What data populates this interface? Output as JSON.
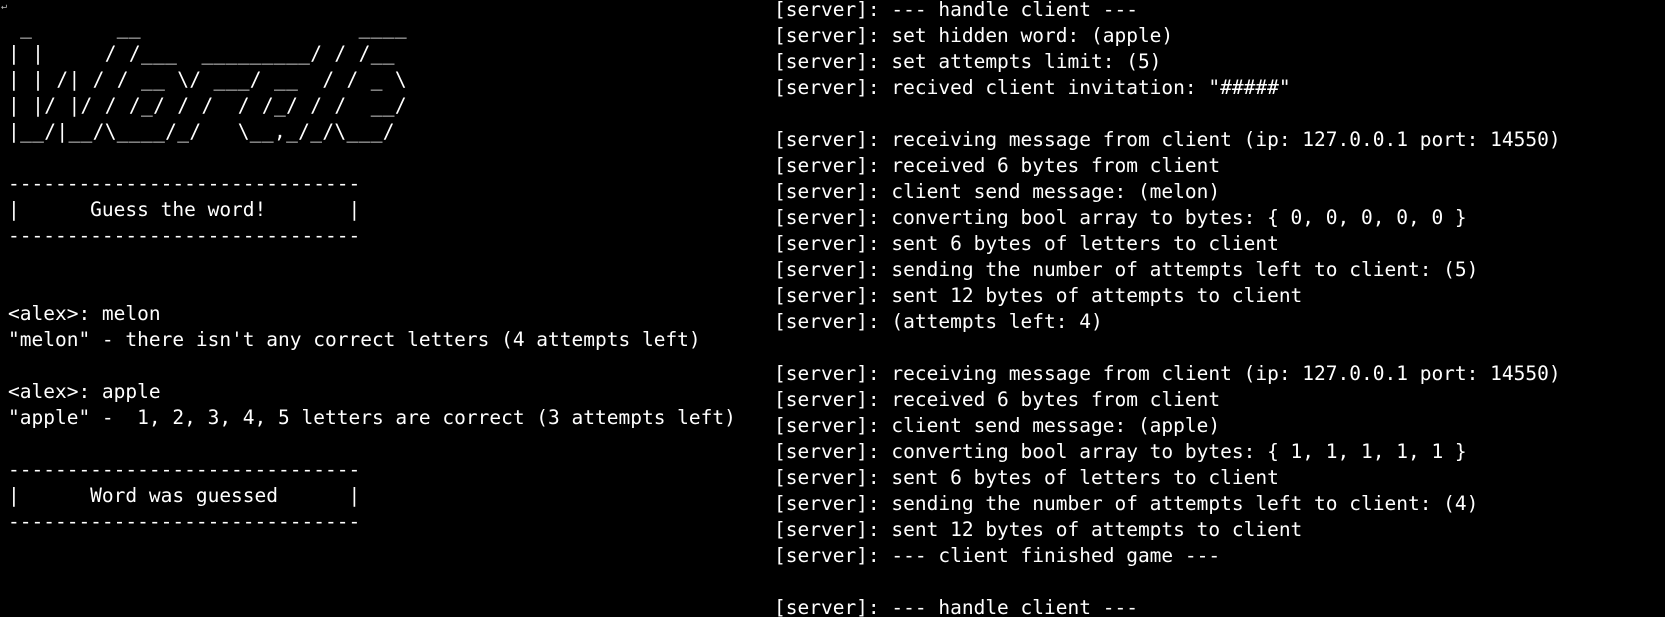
{
  "client": {
    "cursor_glyph": "↵",
    "banner": " _       __                  ____\n| |     / /___  _________/ / /__\n| | /| / / __ \\/ ___/ __  / / _ \\\n| |/ |/ / /_/ / /  / /_/ / /  __/\n|__/|__/\\____/_/   \\__,_/_/\\___/",
    "lines": [
      "",
      "------------------------------",
      "|      Guess the word!       |",
      "------------------------------",
      "",
      "",
      "<alex>: melon",
      "\"melon\" - there isn't any correct letters (4 attempts left)",
      "",
      "<alex>: apple",
      "\"apple\" -  1, 2, 3, 4, 5 letters are correct (3 attempts left)",
      "",
      "------------------------------",
      "|      Word was guessed      |",
      "------------------------------"
    ]
  },
  "server": {
    "lines": [
      "[server]: --- handle client ---",
      "[server]: set hidden word: (apple)",
      "[server]: set attempts limit: (5)",
      "[server]: recived client invitation: \"#####\"",
      "",
      "[server]: receiving message from client (ip: 127.0.0.1 port: 14550)",
      "[server]: received 6 bytes from client",
      "[server]: client send message: (melon)",
      "[server]: converting bool array to bytes: { 0, 0, 0, 0, 0 }",
      "[server]: sent 6 bytes of letters to client",
      "[server]: sending the number of attempts left to client: (5)",
      "[server]: sent 12 bytes of attempts to client",
      "[server]: (attempts left: 4)",
      "",
      "[server]: receiving message from client (ip: 127.0.0.1 port: 14550)",
      "[server]: received 6 bytes from client",
      "[server]: client send message: (apple)",
      "[server]: converting bool array to bytes: { 1, 1, 1, 1, 1 }",
      "[server]: sent 6 bytes of letters to client",
      "[server]: sending the number of attempts left to client: (4)",
      "[server]: sent 12 bytes of attempts to client",
      "[server]: --- client finished game ---",
      "",
      "[server]: --- handle client ---"
    ]
  },
  "colors": {
    "background": "#000000",
    "text": "#ffffff"
  }
}
